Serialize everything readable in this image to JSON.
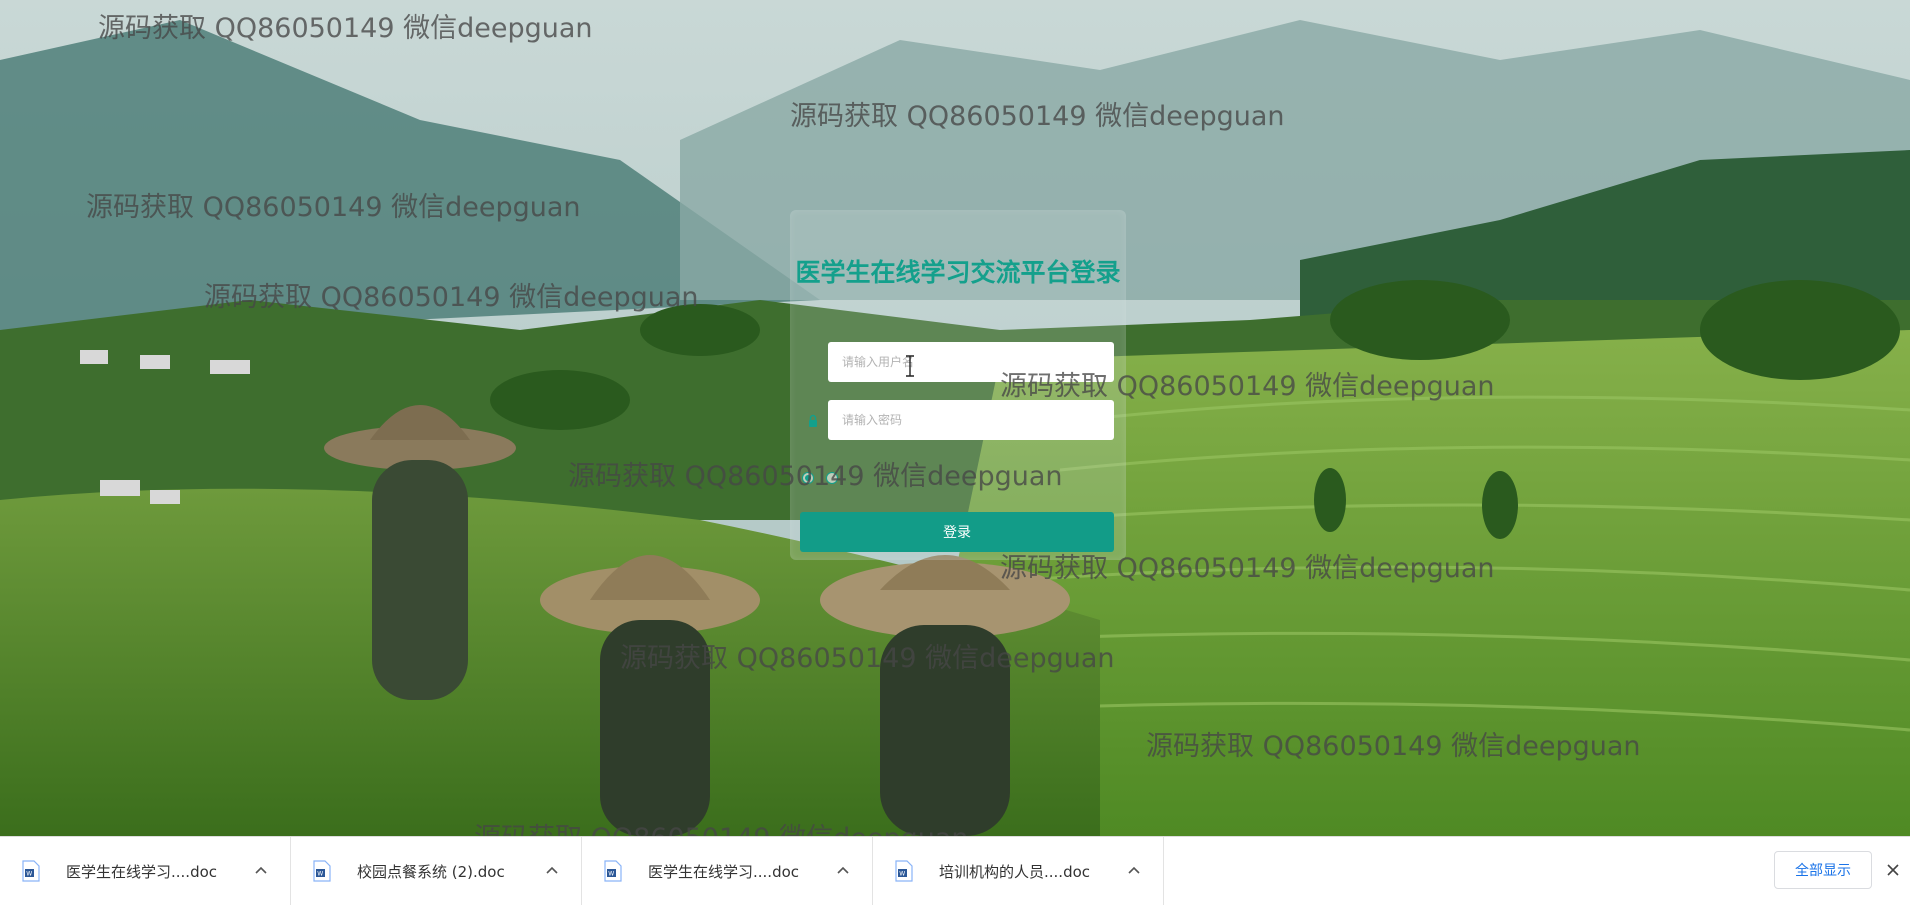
{
  "login": {
    "title": "医学生在线学习交流平台登录",
    "username_placeholder": "请输入用户名",
    "password_placeholder": "请输入密码",
    "submit_label": "登录"
  },
  "watermark": {
    "text": "源码获取 QQ86050149 微信deepguan"
  },
  "downloads": {
    "items": [
      {
        "name": "医学生在线学习....doc"
      },
      {
        "name": "校园点餐系统 (2).doc"
      },
      {
        "name": "医学生在线学习....doc"
      },
      {
        "name": "培训机构的人员....doc"
      }
    ],
    "show_all_label": "全部显示"
  },
  "colors": {
    "accent": "#129c88",
    "title": "#14a08c",
    "link_blue": "#1a73e8"
  },
  "icons": {
    "lock": "lock-icon",
    "file": "word-document-icon",
    "chevron": "chevron-up-icon",
    "close": "close-icon"
  }
}
